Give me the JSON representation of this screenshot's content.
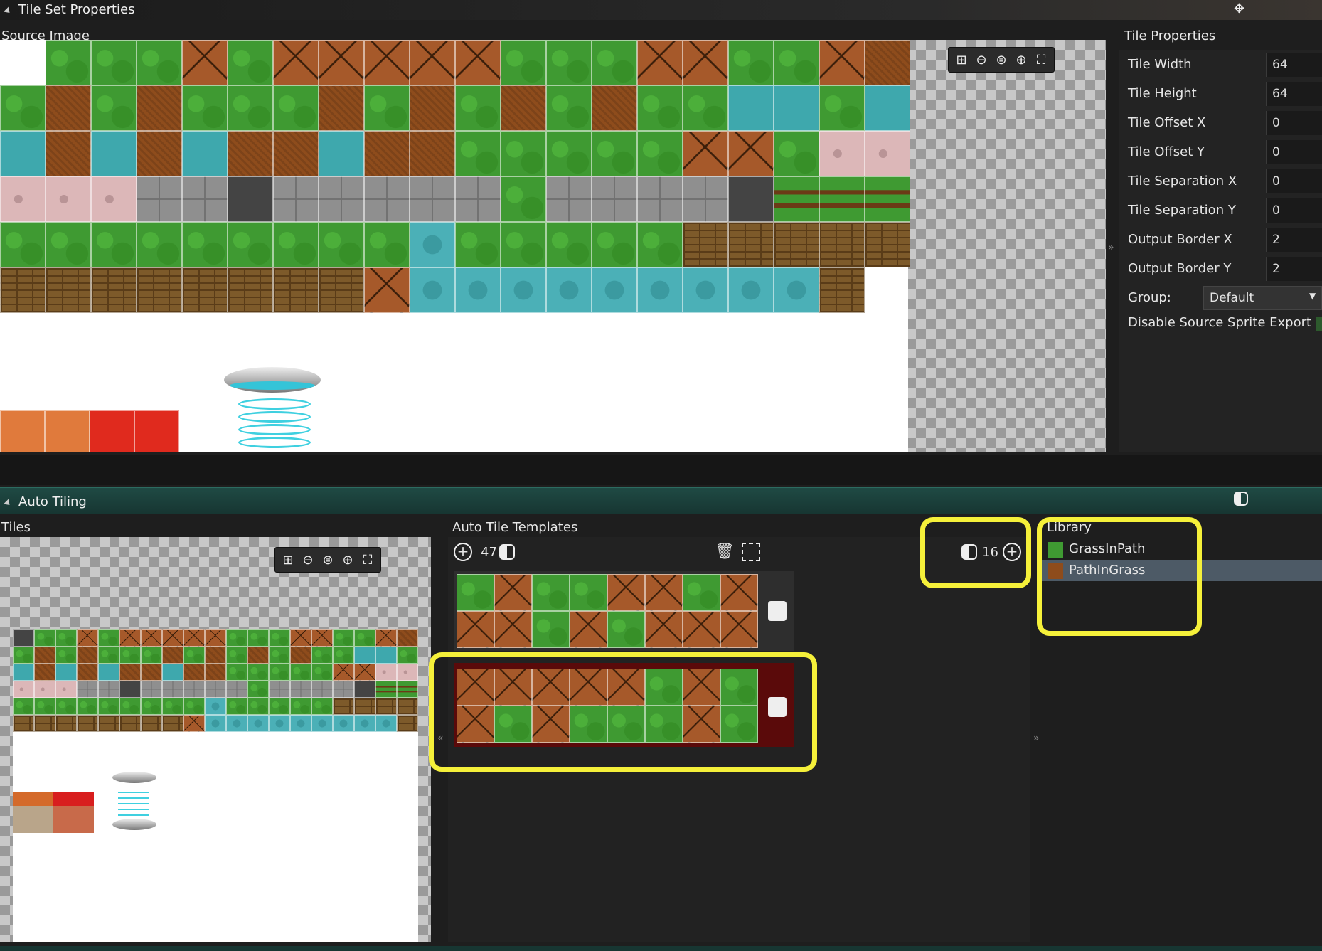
{
  "tileset_panel": {
    "title": "Tile Set Properties",
    "source_image_label": "Source Image"
  },
  "tile_properties": {
    "title": "Tile Properties",
    "rows": [
      {
        "name": "Tile Width",
        "value": "64"
      },
      {
        "name": "Tile Height",
        "value": "64"
      },
      {
        "name": "Tile Offset X",
        "value": "0"
      },
      {
        "name": "Tile Offset Y",
        "value": "0"
      },
      {
        "name": "Tile Separation X",
        "value": "0"
      },
      {
        "name": "Tile Separation Y",
        "value": "0"
      },
      {
        "name": "Output Border X",
        "value": "2"
      },
      {
        "name": "Output Border Y",
        "value": "2"
      }
    ],
    "group_label": "Group:",
    "group_value": "Default",
    "disable_export_label": "Disable Source Sprite Export"
  },
  "auto_tiling": {
    "title": "Auto Tiling",
    "tiles_label": "Tiles",
    "templates_label": "Auto Tile Templates",
    "templates_count": "47",
    "library_count": "16",
    "library_label": "Library",
    "library_items": [
      {
        "name": "GrassInPath",
        "color": "#3f9a32"
      },
      {
        "name": "PathInGrass",
        "color": "#8e4c1c"
      }
    ]
  },
  "icons": {
    "grid": "grid-icon",
    "zoom_out": "zoom-out-icon",
    "zoom_reset": "zoom-reset-icon",
    "zoom_in": "zoom-in-icon",
    "fit": "fit-icon",
    "add": "add-icon",
    "toggle": "toggle-icon",
    "delete": "trash-icon",
    "select": "select-icon"
  },
  "colors": {
    "highlight": "#f5f03a",
    "selected_template_bg": "#5a0a0a",
    "library_selected_bg": "#4d5a66"
  }
}
